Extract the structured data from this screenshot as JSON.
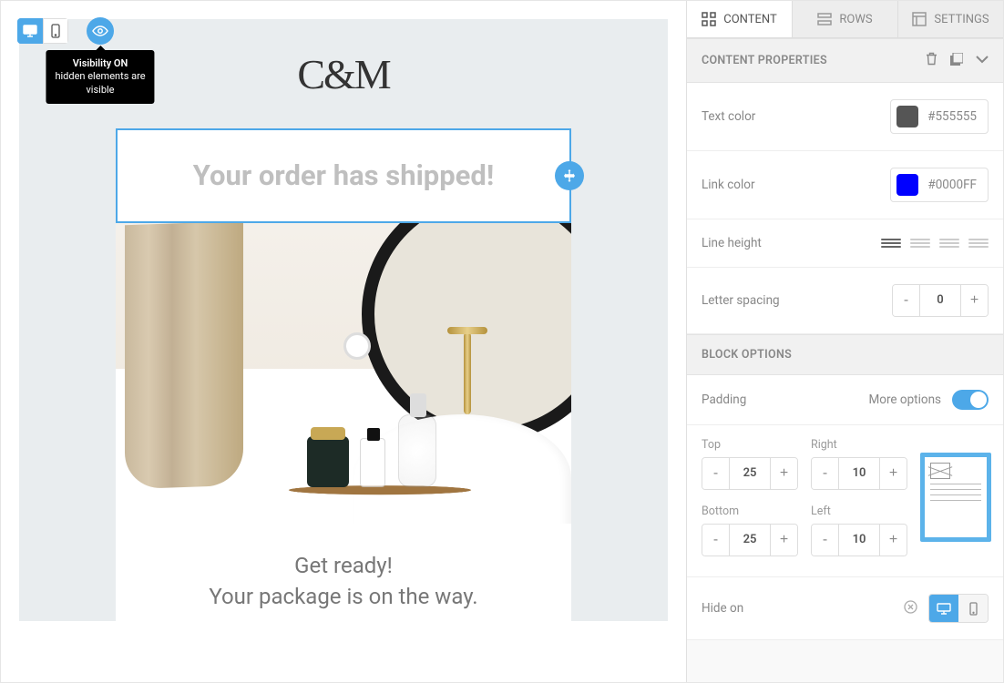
{
  "toolbar": {
    "tooltip_title": "Visibility ON",
    "tooltip_line2": "hidden elements are",
    "tooltip_line3": "visible"
  },
  "email": {
    "logo": "C&M",
    "headline": "Your order has shipped!",
    "subline1": "Get ready!",
    "subline2": "Your package is on the way."
  },
  "tabs": {
    "content": "CONTENT",
    "rows": "ROWS",
    "settings": "SETTINGS"
  },
  "props": {
    "header": "CONTENT PROPERTIES",
    "text_color_label": "Text color",
    "text_color_value": "#555555",
    "text_color_hex": "#555555",
    "link_color_label": "Link color",
    "link_color_value": "#0000FF",
    "link_color_hex": "#0000FF",
    "line_height_label": "Line height",
    "letter_spacing_label": "Letter spacing",
    "letter_spacing_value": "0"
  },
  "block": {
    "header": "BLOCK OPTIONS",
    "padding_label": "Padding",
    "more_options": "More options",
    "top_label": "Top",
    "right_label": "Right",
    "bottom_label": "Bottom",
    "left_label": "Left",
    "top": "25",
    "right": "10",
    "bottom": "25",
    "left": "10",
    "hide_on_label": "Hide on"
  }
}
